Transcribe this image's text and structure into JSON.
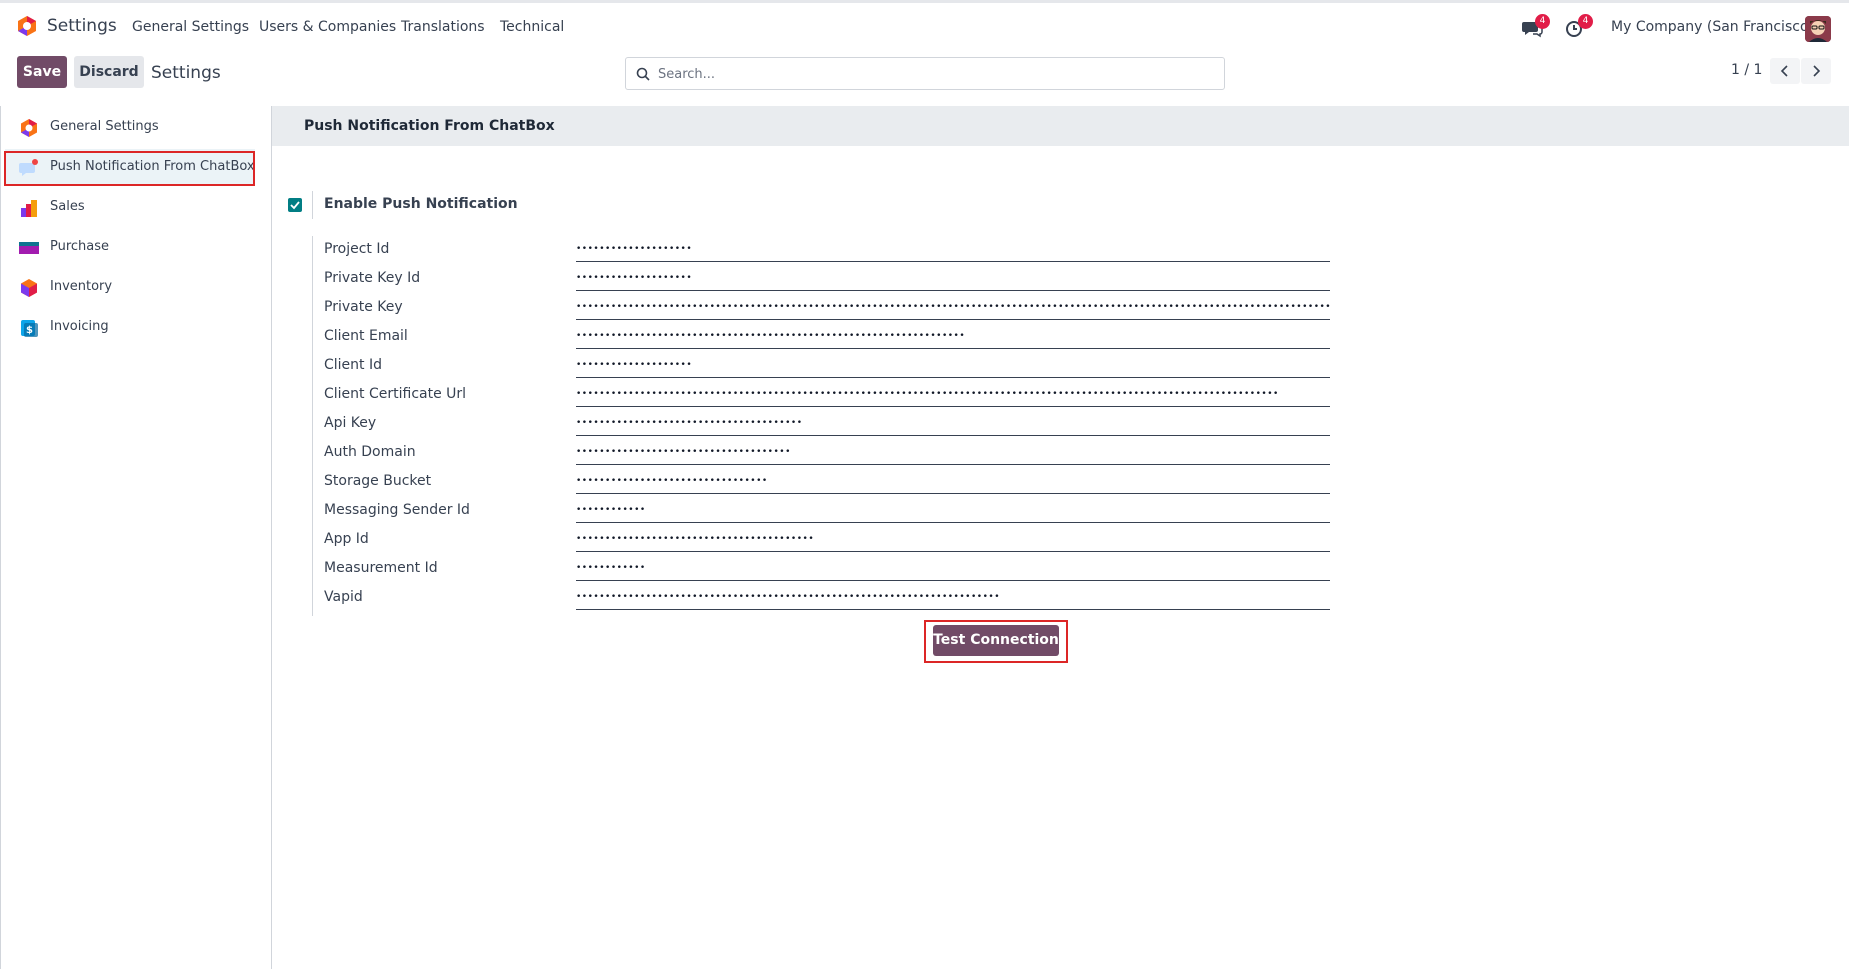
{
  "navbar": {
    "app_name": "Settings",
    "menu": [
      "General Settings",
      "Users & Companies",
      "Translations",
      "Technical"
    ],
    "messages_badge": "4",
    "activities_badge": "4",
    "company": "My Company (San Francisco)"
  },
  "control_panel": {
    "save_label": "Save",
    "discard_label": "Discard",
    "title": "Settings",
    "search_placeholder": "Search...",
    "pager": "1 / 1"
  },
  "sidebar": {
    "items": [
      {
        "label": "General Settings",
        "icon": "odoo-logo-icon"
      },
      {
        "label": "Push Notification From ChatBox",
        "icon": "chatbox-icon"
      },
      {
        "label": "Sales",
        "icon": "sales-icon"
      },
      {
        "label": "Purchase",
        "icon": "purchase-icon"
      },
      {
        "label": "Inventory",
        "icon": "inventory-icon"
      },
      {
        "label": "Invoicing",
        "icon": "invoicing-icon"
      }
    ]
  },
  "section": {
    "title": "Push Notification From ChatBox",
    "enable_label": "Enable Push Notification",
    "enable_checked": true,
    "fields": [
      {
        "label": "Project Id",
        "value": "••••••••••••••••••••"
      },
      {
        "label": "Private Key Id",
        "value": "••••••••••••••••••••"
      },
      {
        "label": "Private Key",
        "value": "••••••••••••••••••••••••••••••••••••••••••••••••••••••••••••••••••••••••••••••••••••••••••••••••••••••••••••••••••••••••••••••••••••••••••••••••••••"
      },
      {
        "label": "Client Email",
        "value": "•••••••••••••••••••••••••••••••••••••••••••••••••••••••••••••••••••"
      },
      {
        "label": "Client Id",
        "value": "••••••••••••••••••••"
      },
      {
        "label": "Client Certificate Url",
        "value": "•••••••••••••••••••••••••••••••••••••••••••••••••••••••••••••••••••••••••••••••••••••••••••••••••••••••••••••••••••••••••"
      },
      {
        "label": "Api Key",
        "value": "•••••••••••••••••••••••••••••••••••••••"
      },
      {
        "label": "Auth Domain",
        "value": "•••••••••••••••••••••••••••••••••••••"
      },
      {
        "label": "Storage Bucket",
        "value": "•••••••••••••••••••••••••••••••••"
      },
      {
        "label": "Messaging Sender Id",
        "value": "••••••••••••"
      },
      {
        "label": "App Id",
        "value": "•••••••••••••••••••••••••••••••••••••••••"
      },
      {
        "label": "Measurement Id",
        "value": "••••••••••••"
      },
      {
        "label": "Vapid",
        "value": "•••••••••••••••••••••••••••••••••••••••••••••••••••••••••••••••••••••••••"
      }
    ],
    "test_button_label": "Test Connection"
  },
  "colors": {
    "primary": "#714b67",
    "checkbox": "#017e84",
    "highlight": "#dc2626",
    "badge": "#e11d48"
  }
}
